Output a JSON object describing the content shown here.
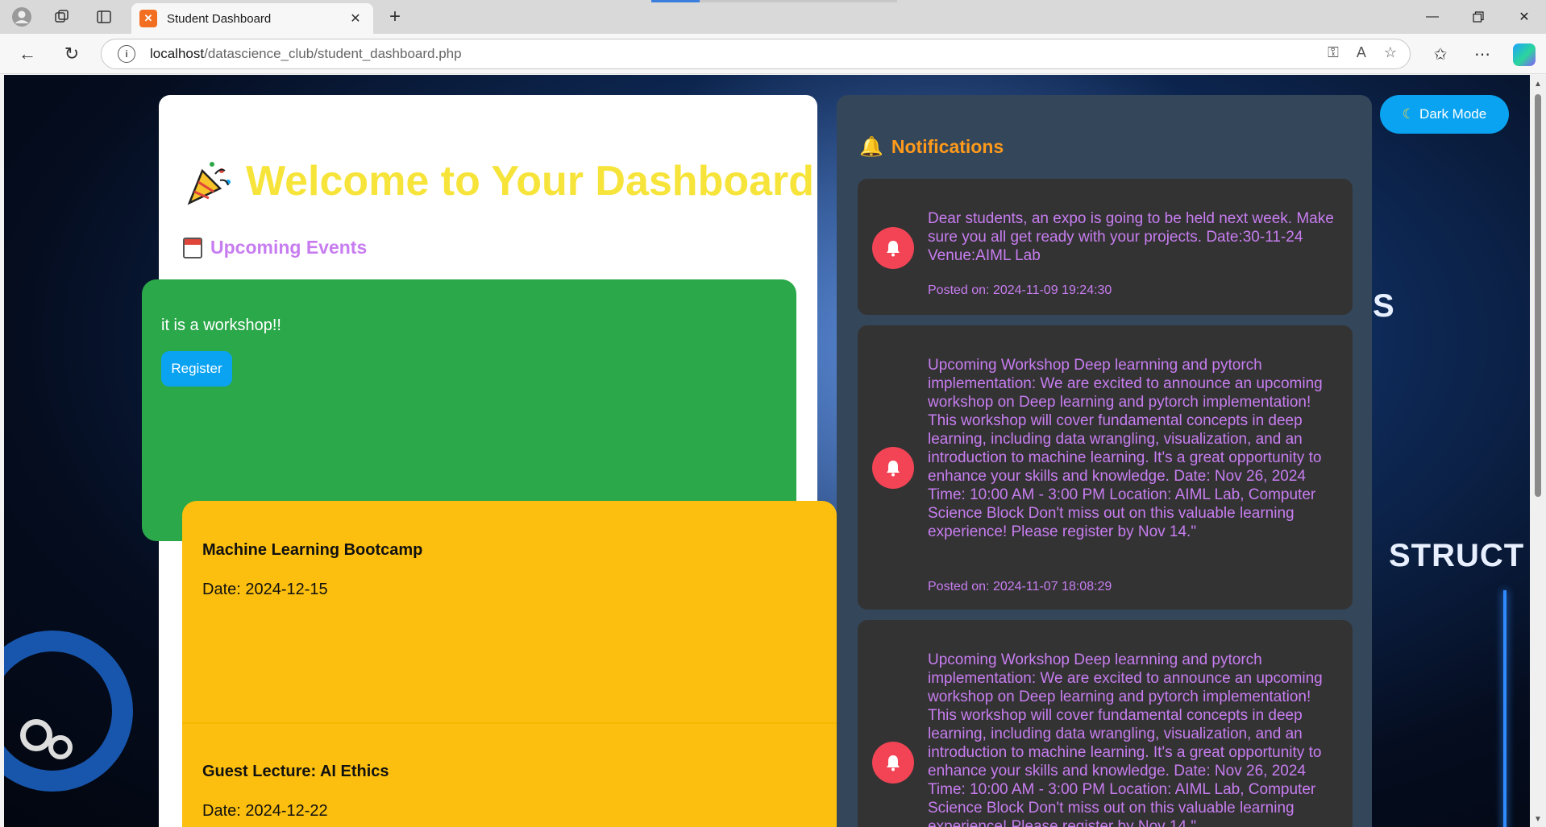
{
  "browser": {
    "tab_title": "Student Dashboard",
    "url_host": "localhost",
    "url_path": "/datascience_club/student_dashboard.php"
  },
  "dashboard": {
    "welcome_title": "Welcome to Your Dashboard",
    "upcoming_title": "Upcoming Events",
    "events": [
      {
        "description": "it is a workshop!!",
        "register_label": "Register",
        "color": "#2ba84a"
      },
      {
        "title": "Machine Learning Bootcamp",
        "date": "Date: 2024-12-15",
        "color": "#fcbf0f"
      },
      {
        "title": "Guest Lecture: AI Ethics",
        "date": "Date: 2024-12-22",
        "color": "#fcbf0f"
      }
    ]
  },
  "notifications": {
    "title": "Notifications",
    "items": [
      {
        "message": "Dear students, an expo is going to be held next week. Make sure you all get ready with your projects. Date:30-11-24 Venue:AIML Lab",
        "posted": "Posted on: 2024-11-09 19:24:30"
      },
      {
        "message": "Upcoming Workshop Deep learnning and pytorch implementation: We are excited to announce an upcoming workshop on Deep learning and pytorch implementation! This workshop will cover fundamental concepts in deep learning, including data wrangling, visualization, and an introduction to machine learning. It's a great opportunity to enhance your skills and knowledge. Date: Nov 26, 2024 Time: 10:00 AM - 3:00 PM Location: AIML Lab, Computer Science Block Don't miss out on this valuable learning experience! Please register by Nov 14.\"",
        "posted": "Posted on: 2024-11-07 18:08:29"
      },
      {
        "message": "Upcoming Workshop Deep learnning and pytorch implementation: We are excited to announce an upcoming workshop on Deep learning and pytorch implementation! This workshop will cover fundamental concepts in deep learning, including data wrangling, visualization, and an introduction to machine learning. It's a great opportunity to enhance your skills and knowledge. Date: Nov 26, 2024 Time: 10:00 AM - 3:00 PM Location: AIML Lab, Computer Science Block Don't miss out on this valuable learning experience! Please register by Nov 14.\""
      }
    ]
  },
  "dark_mode_label": "Dark Mode",
  "background": {
    "text_right": "STRUCT",
    "text_top": "S"
  },
  "colors": {
    "welcome": "#f7e43a",
    "section_title": "#c77df0",
    "notif_title": "#ff9a1a",
    "notif_text": "#c77df0",
    "button": "#0aa3f2",
    "bell_badge": "#f24455"
  }
}
